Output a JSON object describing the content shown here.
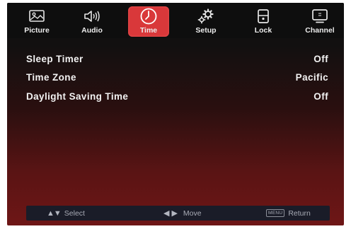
{
  "tabs": [
    {
      "label": "Picture",
      "icon": "picture-icon",
      "active": false
    },
    {
      "label": "Audio",
      "icon": "speaker-icon",
      "active": false
    },
    {
      "label": "Time",
      "icon": "clock-icon",
      "active": true
    },
    {
      "label": "Setup",
      "icon": "gears-icon",
      "active": false
    },
    {
      "label": "Lock",
      "icon": "lock-icon",
      "active": false
    },
    {
      "label": "Channel",
      "icon": "tv-icon",
      "active": false
    }
  ],
  "settings": [
    {
      "name": "Sleep Timer",
      "value": "Off"
    },
    {
      "name": "Time Zone",
      "value": "Pacific"
    },
    {
      "name": "Daylight Saving Time",
      "value": "Off"
    }
  ],
  "footer": {
    "select_label": "Select",
    "move_label": "Move",
    "menu_key": "MENU",
    "return_label": "Return"
  },
  "colors": {
    "active_tab": "#d9383a",
    "background_top": "#101010",
    "background_bottom": "#6e1616",
    "footer_bar": "#1a1c28"
  }
}
